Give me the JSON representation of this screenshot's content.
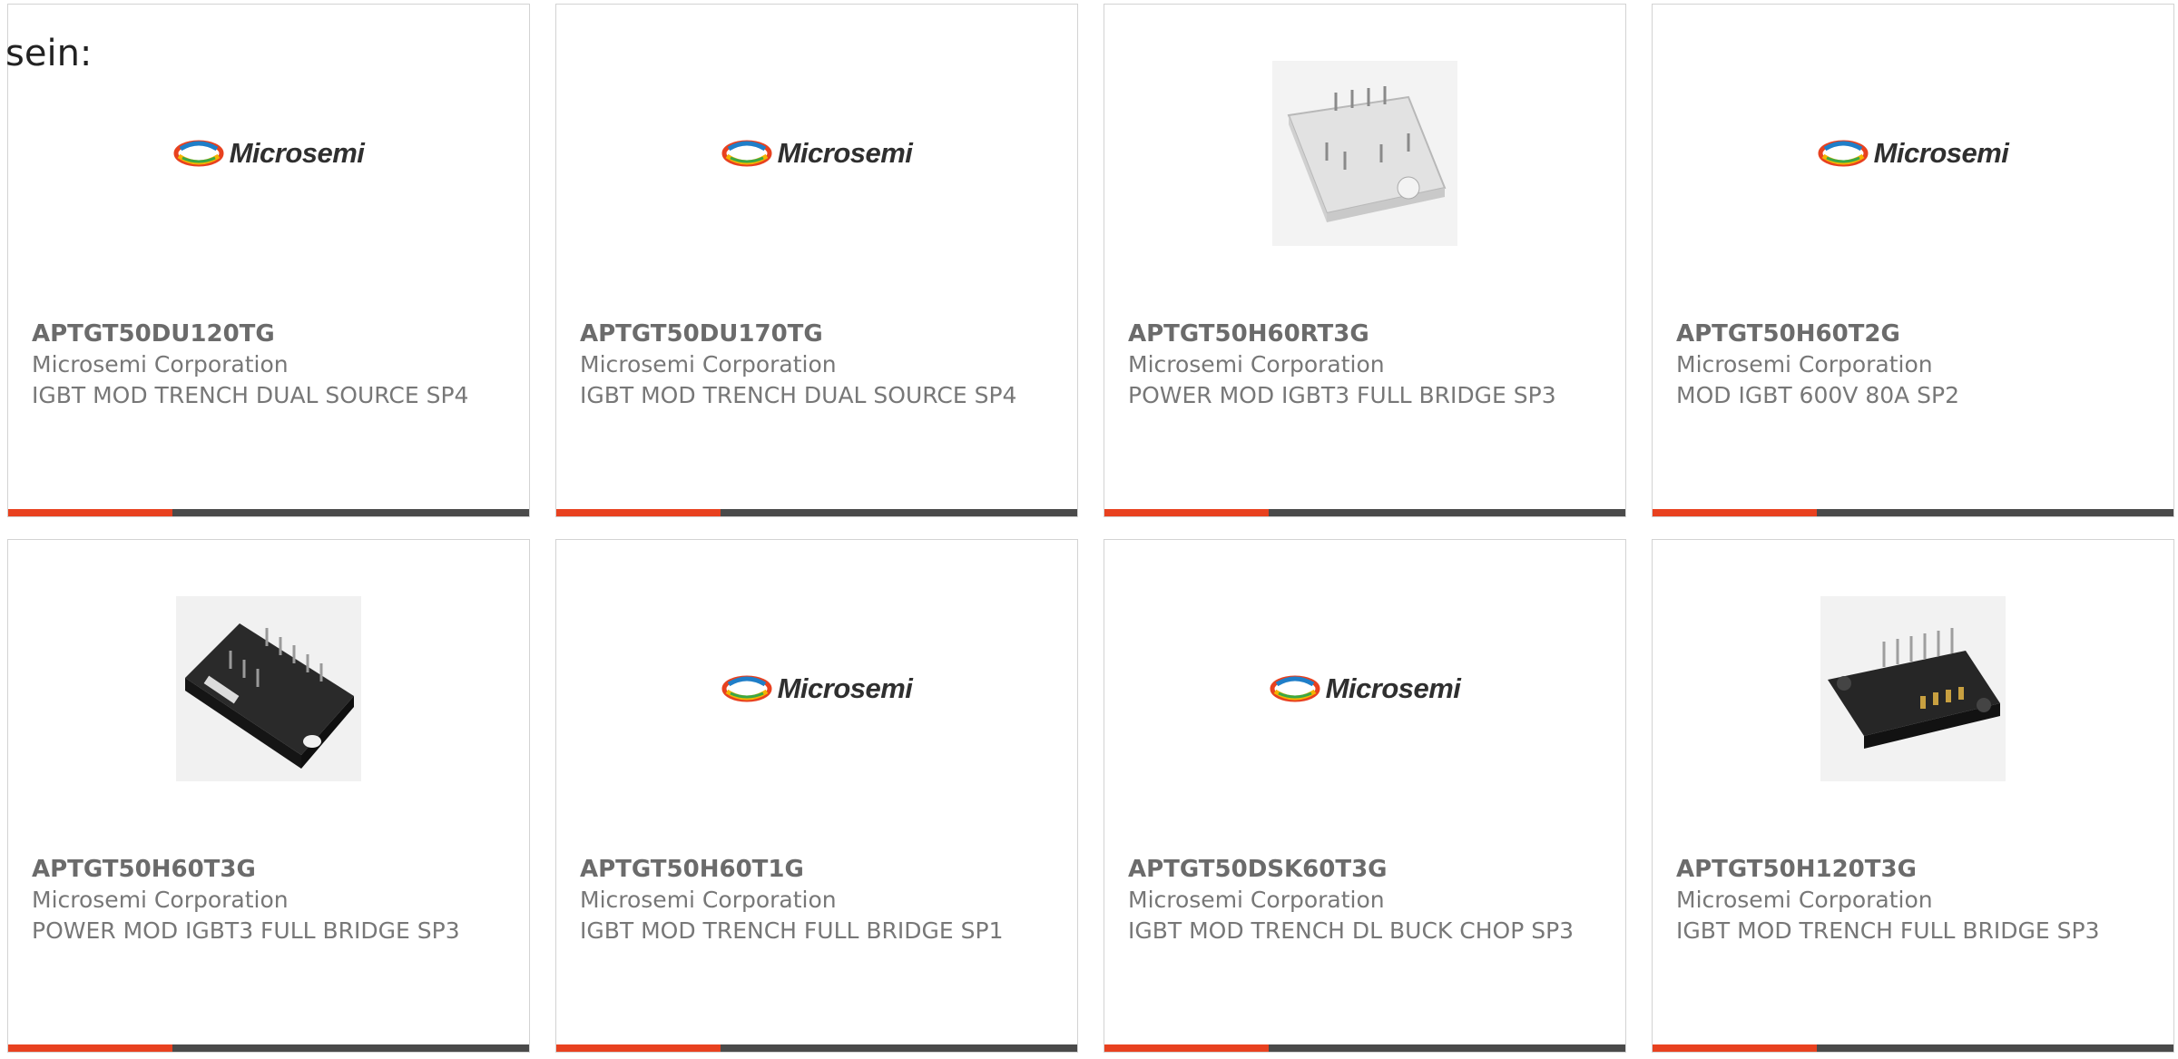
{
  "intro_text": "sein:",
  "brand": {
    "logo_text": "Microsemi",
    "accent_color": "#e8411f"
  },
  "products": [
    {
      "part_number": "APTGT50DU120TG",
      "manufacturer": "Microsemi Corporation",
      "description": "IGBT MOD TRENCH DUAL SOURCE SP4",
      "image": "microsemi-logo"
    },
    {
      "part_number": "APTGT50DU170TG",
      "manufacturer": "Microsemi Corporation",
      "description": "IGBT MOD TRENCH DUAL SOURCE SP4",
      "image": "microsemi-logo"
    },
    {
      "part_number": "APTGT50H60RT3G",
      "manufacturer": "Microsemi Corporation",
      "description": "POWER MOD IGBT3 FULL BRIDGE SP3",
      "image": "white-power-module"
    },
    {
      "part_number": "APTGT50H60T2G",
      "manufacturer": "Microsemi Corporation",
      "description": "MOD IGBT 600V 80A SP2",
      "image": "microsemi-logo"
    },
    {
      "part_number": "APTGT50H60T3G",
      "manufacturer": "Microsemi Corporation",
      "description": "POWER MOD IGBT3 FULL BRIDGE SP3",
      "image": "black-power-module"
    },
    {
      "part_number": "APTGT50H60T1G",
      "manufacturer": "Microsemi Corporation",
      "description": "IGBT MOD TRENCH FULL BRIDGE SP1",
      "image": "microsemi-logo"
    },
    {
      "part_number": "APTGT50DSK60T3G",
      "manufacturer": "Microsemi Corporation",
      "description": "IGBT MOD TRENCH DL BUCK CHOP SP3",
      "image": "microsemi-logo"
    },
    {
      "part_number": "APTGT50H120T3G",
      "manufacturer": "Microsemi Corporation",
      "description": "IGBT MOD TRENCH FULL BRIDGE SP3",
      "image": "black-connector-module"
    }
  ]
}
